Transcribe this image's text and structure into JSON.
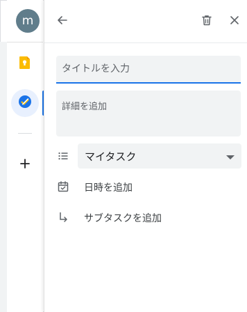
{
  "rail": {
    "avatar_letter": "m",
    "icons": [
      "keep-icon",
      "tasks-icon",
      "add-icon"
    ]
  },
  "panel": {
    "header_icons": [
      "back-arrow-icon",
      "trash-icon",
      "close-icon"
    ],
    "title_placeholder": "タイトルを入力",
    "details_placeholder": "詳細を追加",
    "list_selected": "マイタスク",
    "add_date_label": "日時を追加",
    "add_subtask_label": "サブタスクを追加"
  },
  "colors": {
    "accent": "#1a73e8",
    "keep_yellow": "#fbbc04",
    "avatar_bg": "#607d8b"
  }
}
